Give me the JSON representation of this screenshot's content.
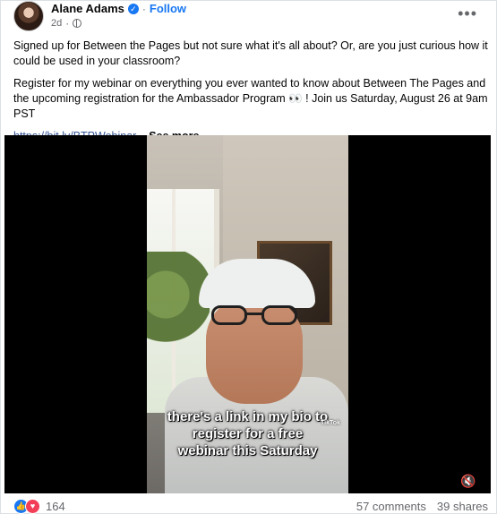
{
  "post": {
    "author": "Alane Adams",
    "follow_label": "Follow",
    "time": "2d",
    "more_label": "•••",
    "text_p1": "Signed up for Between the Pages but not sure what it's all about? Or, are you just curious how it could be used in your classroom?",
    "text_p2": "Register for my webinar on everything you ever wanted to know about Between The Pages and the upcoming registration for the Ambassador Program 👀 ! Join us Saturday, August 26 at 9am PST",
    "link_text": "https://bit.ly/BTPWebinar",
    "see_more": "... See more"
  },
  "video": {
    "caption_line1": "there's a link in my bio to",
    "caption_line2": "register for a free",
    "caption_line3": "webinar this Saturday",
    "tiktok_label": "TikTok"
  },
  "footer": {
    "reaction_count": "164",
    "comments": "57 comments",
    "shares": "39 shares"
  },
  "colors": {
    "accent": "#1877f2",
    "love": "#f33e58",
    "secondary_text": "#65676b"
  },
  "icons": [
    "avatar",
    "verified-badge-icon",
    "globe-icon",
    "more-options-icon",
    "mute-icon",
    "like-icon",
    "love-icon"
  ]
}
